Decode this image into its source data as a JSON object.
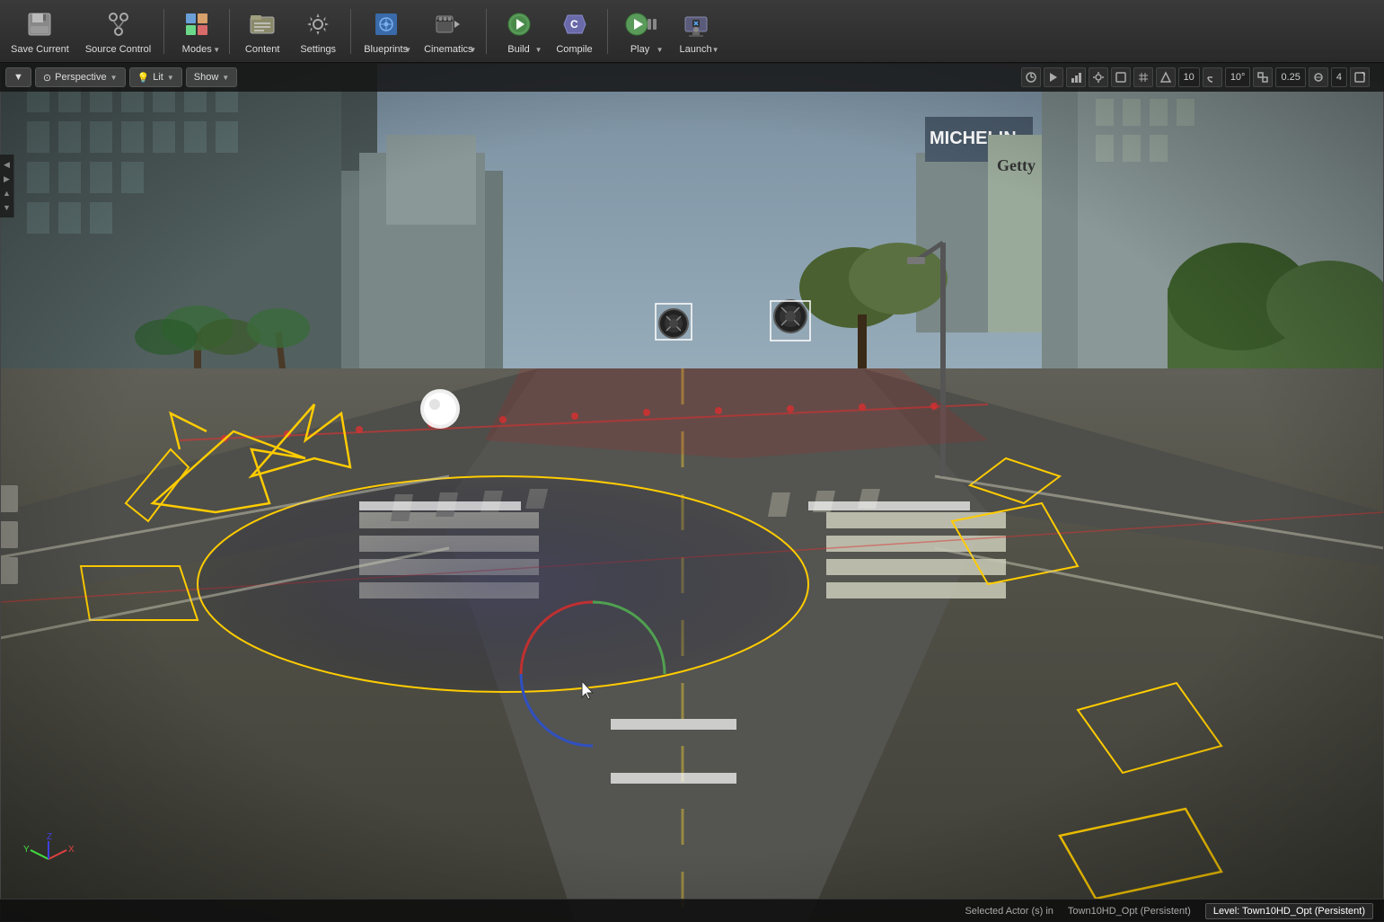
{
  "toolbar": {
    "save_current": "Save Current",
    "source_control": "Source Control",
    "modes": "Modes",
    "content": "Content",
    "settings": "Settings",
    "blueprints": "Blueprints",
    "cinematics": "Cinematics",
    "build": "Build",
    "compile": "Compile",
    "play": "Play",
    "launch": "Launch"
  },
  "viewport": {
    "perspective_label": "Perspective",
    "lit_label": "Lit",
    "show_label": "Show",
    "snap_value": "10",
    "rotation_snap": "10°",
    "scale_snap": "0.25",
    "grid_snap": "4"
  },
  "status": {
    "selected_actor": "Selected Actor (s) in",
    "level_file": "Town10HD_Opt (Persistent)",
    "level_label": "Level: Town10HD_Opt (Persistent)"
  }
}
